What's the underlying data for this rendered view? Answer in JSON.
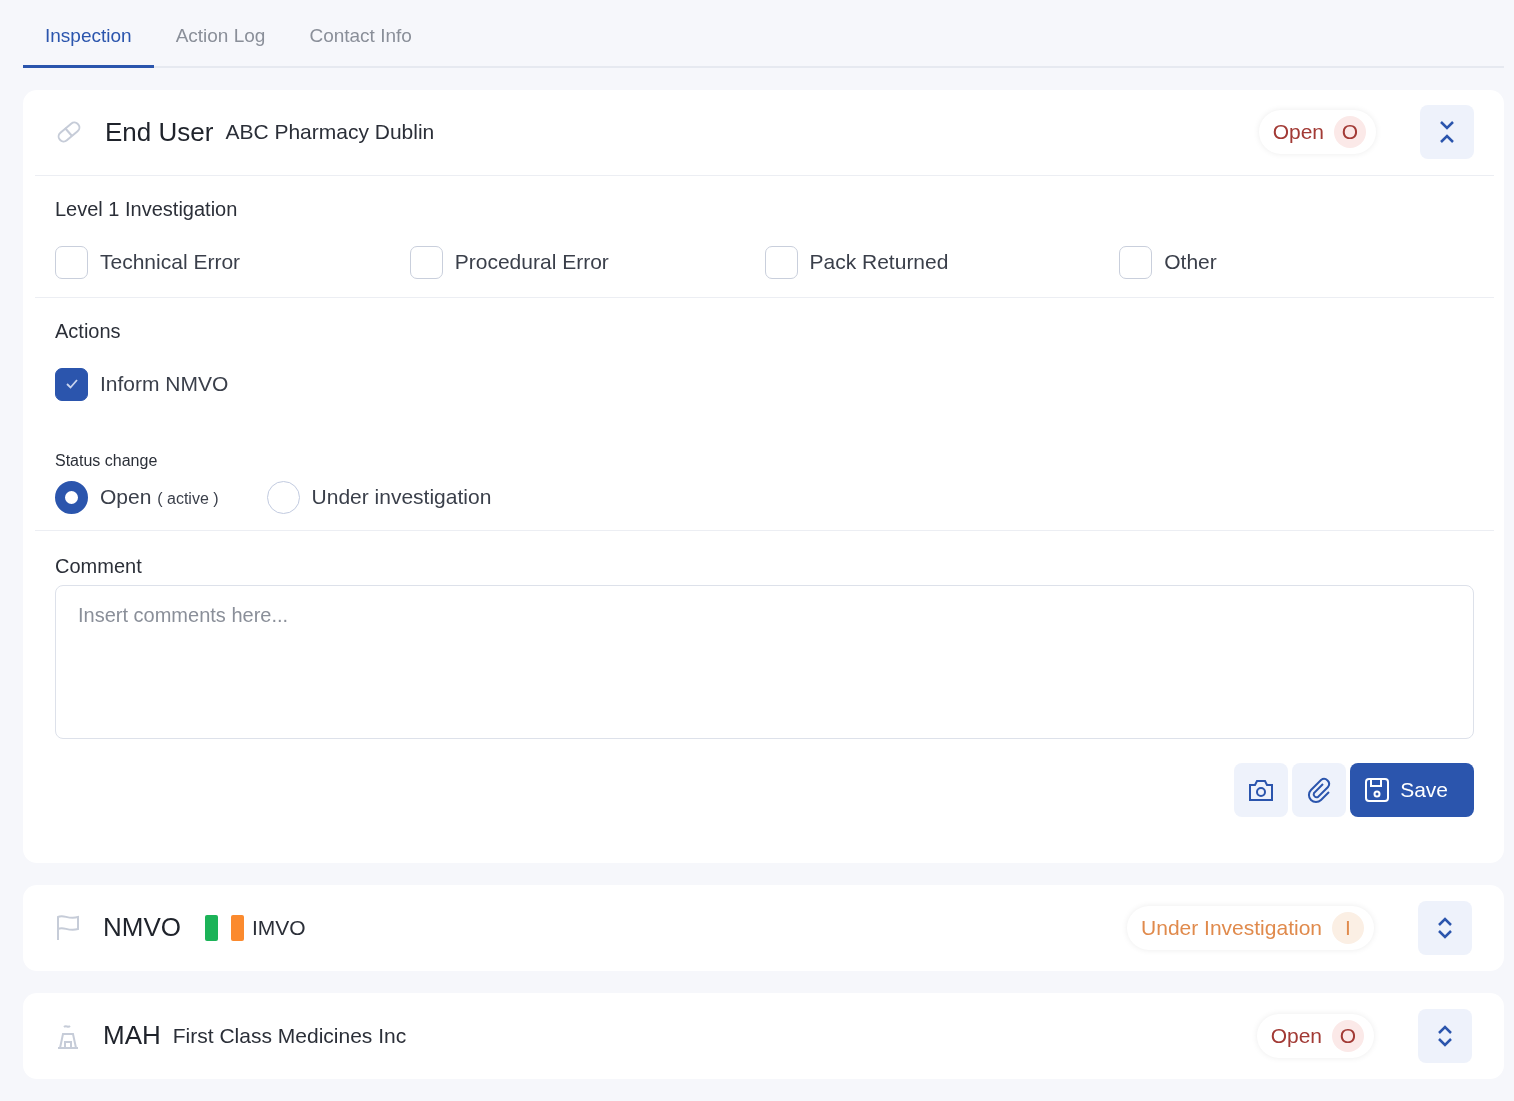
{
  "tabs": [
    {
      "label": "Inspection",
      "selected": true
    },
    {
      "label": "Action Log",
      "selected": false
    },
    {
      "label": "Contact Info",
      "selected": false
    }
  ],
  "panels": [
    {
      "title": "End User",
      "subtitle": "ABC Pharmacy Dublin",
      "has_flag": false,
      "status": {
        "kind": "open",
        "label": "Open",
        "letter": "O"
      },
      "expanded": true,
      "body": {
        "investigation": {
          "heading": "Level 1 Investigation",
          "options": [
            {
              "label": "Technical Error",
              "checked": false
            },
            {
              "label": "Procedural Error",
              "checked": false
            },
            {
              "label": "Pack Returned",
              "checked": false
            },
            {
              "label": "Other",
              "checked": false
            }
          ]
        },
        "actions": {
          "heading": "Actions",
          "options": [
            {
              "label": "Inform NMVO",
              "checked": true
            }
          ]
        },
        "status_change": {
          "heading": "Status change",
          "options": [
            {
              "label": "Open",
              "note": "( active )",
              "selected": true
            },
            {
              "label": "Under investigation",
              "selected": false
            }
          ]
        },
        "comment": {
          "heading": "Comment",
          "placeholder": "Insert comments here..."
        },
        "save_label": "Save"
      }
    },
    {
      "title": "NMVO",
      "subtitle": "IMVO",
      "has_flag": true,
      "status": {
        "kind": "investigation",
        "label": "Under Investigation",
        "letter": "I"
      },
      "expanded": false
    },
    {
      "title": "MAH",
      "subtitle": "First Class Medicines Inc",
      "has_flag": false,
      "status": {
        "kind": "open",
        "label": "Open",
        "letter": "O"
      },
      "expanded": false
    }
  ]
}
